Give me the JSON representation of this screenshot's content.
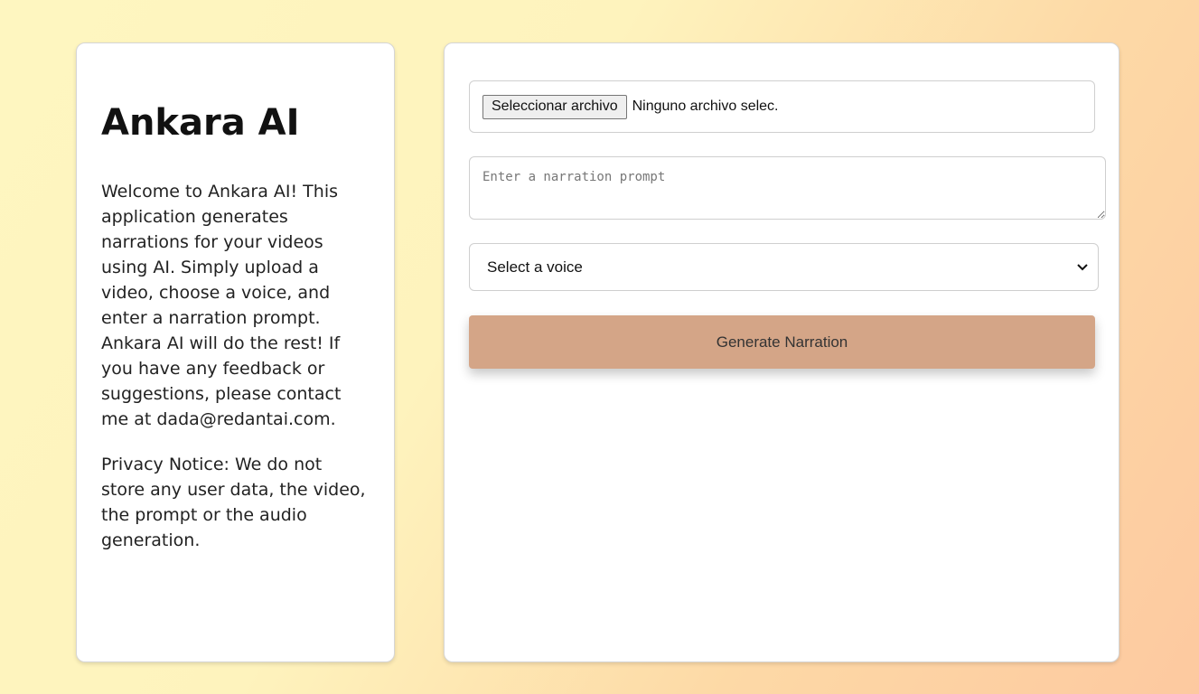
{
  "sidebar": {
    "title": "Ankara AI",
    "description": "Welcome to Ankara AI! This application generates narrations for your videos using AI. Simply upload a video, choose a voice, and enter a narration prompt. Ankara AI will do the rest! If you have any feedback or suggestions, please contact me at dada@redantai.com.",
    "privacy": "Privacy Notice: We do not store any user data, the video, the prompt or the audio generation."
  },
  "form": {
    "file_button_label": "Seleccionar archivo",
    "file_status": "Ninguno archivo selec.",
    "prompt_placeholder": "Enter a narration prompt",
    "prompt_value": "",
    "voice_selected": "Select a voice",
    "voice_icon": "chevron-down-icon",
    "generate_label": "Generate Narration"
  },
  "colors": {
    "button_bg": "#d4a587",
    "card_bg": "#ffffff"
  }
}
